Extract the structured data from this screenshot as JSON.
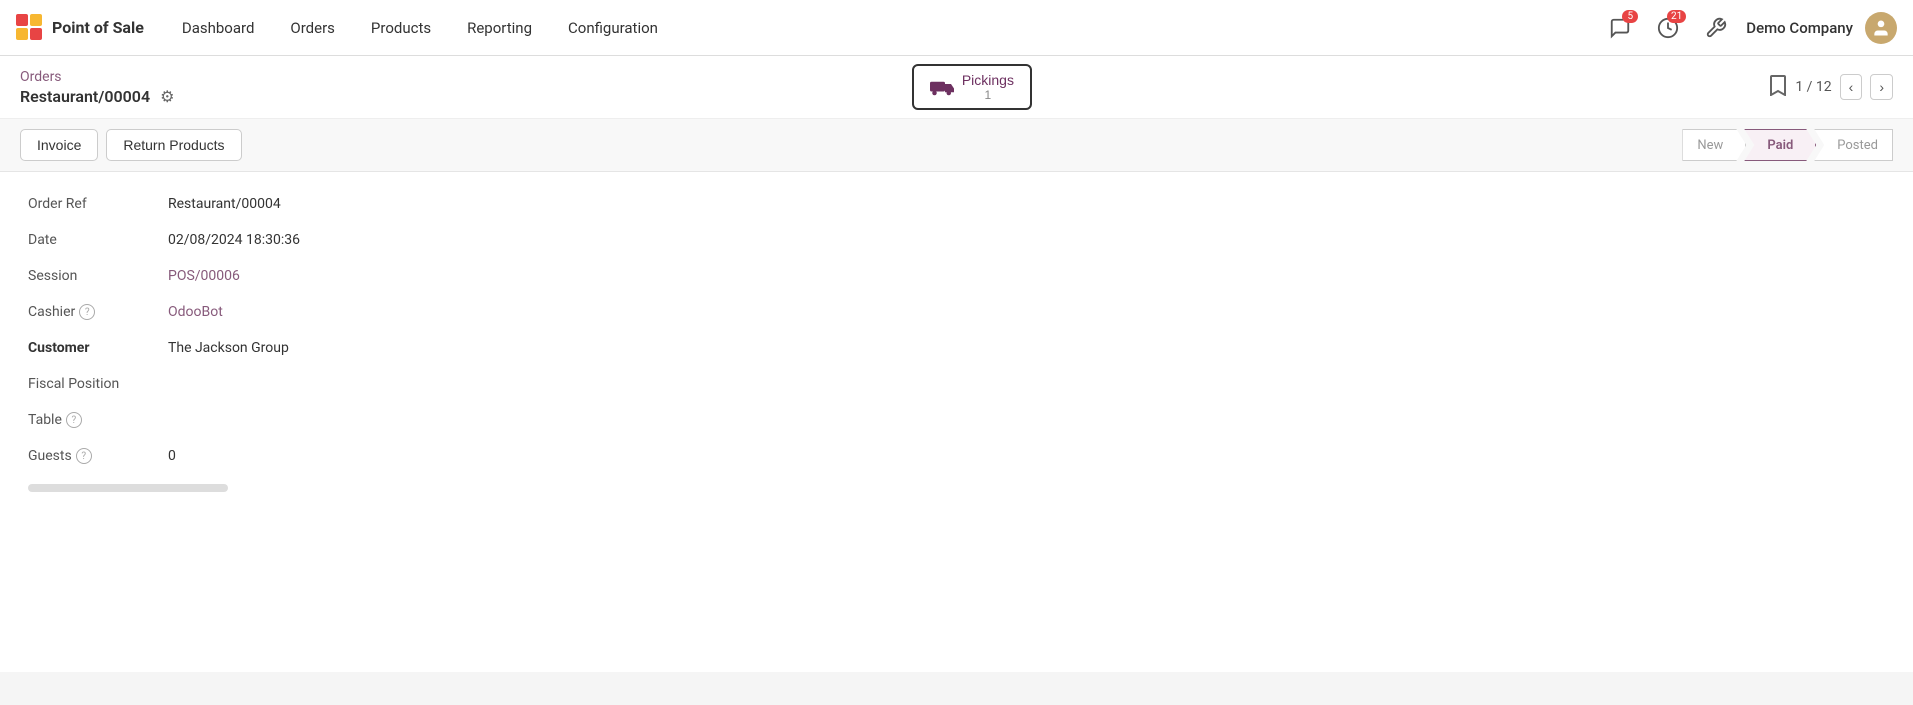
{
  "app": {
    "brand_name": "Point of Sale",
    "brand_icon_colors": [
      "#e84444",
      "#f7b731"
    ]
  },
  "nav": {
    "links": [
      "Dashboard",
      "Orders",
      "Products",
      "Reporting",
      "Configuration"
    ],
    "notifications_count": "5",
    "clock_count": "21",
    "company": "Demo Company"
  },
  "breadcrumb": {
    "parent": "Orders",
    "current": "Restaurant/00004"
  },
  "pickings": {
    "label": "Pickings",
    "count": "1"
  },
  "pager": {
    "text": "1 / 12"
  },
  "actions": {
    "invoice_label": "Invoice",
    "return_label": "Return Products"
  },
  "status": {
    "steps": [
      "New",
      "Paid",
      "Posted"
    ],
    "active": "Paid"
  },
  "form": {
    "order_ref_label": "Order Ref",
    "order_ref_value": "Restaurant/00004",
    "date_label": "Date",
    "date_value": "02/08/2024 18:30:36",
    "session_label": "Session",
    "session_value": "POS/00006",
    "cashier_label": "Cashier",
    "cashier_value": "OdooBot",
    "customer_label": "Customer",
    "customer_value": "The Jackson Group",
    "fiscal_label": "Fiscal Position",
    "fiscal_value": "",
    "table_label": "Table",
    "table_value": "",
    "guests_label": "Guests",
    "guests_value": "0"
  }
}
